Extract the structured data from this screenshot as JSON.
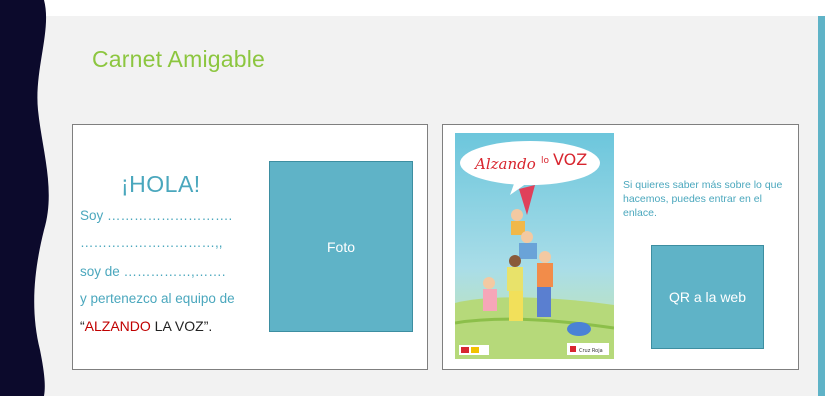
{
  "slide": {
    "title": "Carnet Amigable"
  },
  "card_left": {
    "greeting": "¡HOLA!",
    "line1": "Soy ……………………….",
    "line2": "…………………………,,",
    "line3": "soy de ……………,…….",
    "line4": "y pertenezco al equipo de",
    "quote_open": "“",
    "team_red": "ALZANDO",
    "team_rest": " LA VOZ",
    "quote_close": "”.",
    "photo_label": "Foto"
  },
  "card_right": {
    "poster": {
      "title_prefix": "Alzando",
      "title_lo": "lo",
      "title_voz": "VOZ",
      "logo_text": "Cruz Roja",
      "image": "illustrated-children-tower-poster"
    },
    "info": "Si quieres saber más sobre lo que hacemos, puedes entrar en el enlace.",
    "qr_label": "QR a la web"
  },
  "colors": {
    "accent_green": "#8cc63f",
    "accent_teal": "#4aa7bd",
    "box_teal": "#5fb3c7",
    "dark_navy": "#0c0a2c",
    "highlight_red": "#c00000"
  }
}
